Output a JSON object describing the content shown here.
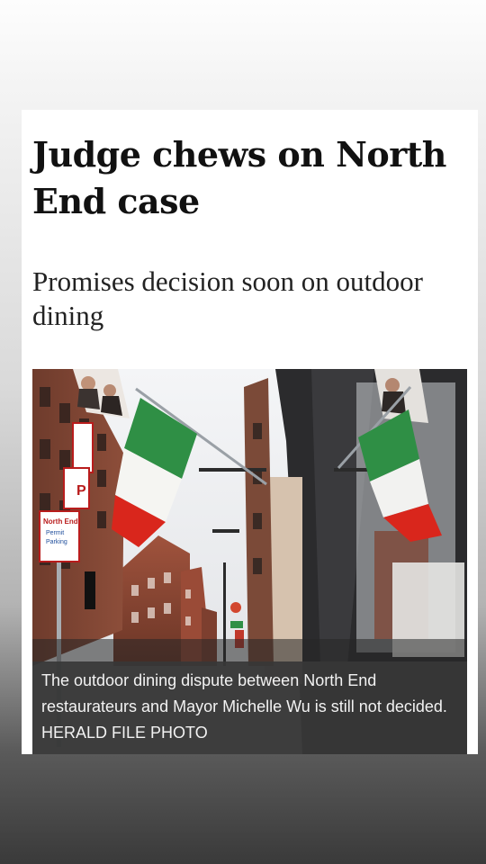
{
  "article": {
    "headline": "Judge chews on North End case",
    "subheadline": "Promises decision soon on outdoor dining",
    "photo": {
      "caption": "The outdoor dining dispute between North End restaurateurs and Mayor Michelle Wu is still not decided. HERALD FILE PHOTO",
      "street_sign": [
        "North End",
        "Permit",
        "Parking"
      ],
      "flag_colors": [
        "#2f8f45",
        "#f7f7f4",
        "#d9261c"
      ]
    }
  }
}
